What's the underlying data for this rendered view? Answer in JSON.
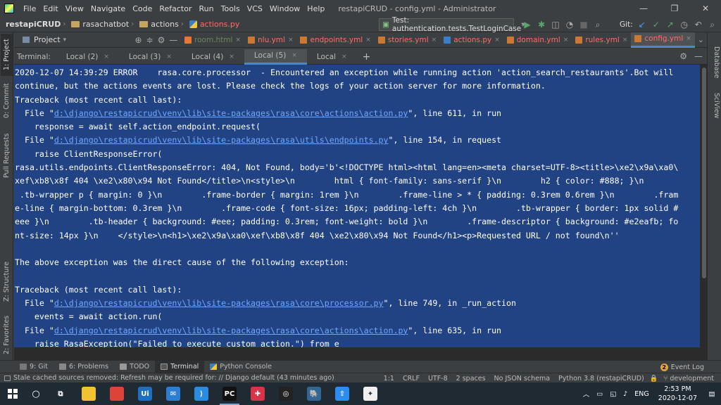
{
  "titlebar": {
    "menu": [
      "File",
      "Edit",
      "View",
      "Navigate",
      "Code",
      "Refactor",
      "Run",
      "Tools",
      "VCS",
      "Window",
      "Help"
    ],
    "title": "restapiCRUD - config.yml - Administrator",
    "minimize": "—",
    "restore": "❐",
    "close": "✕"
  },
  "navbar": {
    "crumbs": [
      "restapiCRUD",
      "rasachatbot",
      "actions",
      "actions.py"
    ],
    "run_config": "Test: authentication.tests.TestLoginCase",
    "git_label": "Git:"
  },
  "project_panel": {
    "label": "Project"
  },
  "editor_tabs": [
    {
      "label": "room.html",
      "color": "#6a8759",
      "icon_color": "#e37933"
    },
    {
      "label": "nlu.yml",
      "color": "#ff6b68",
      "icon_color": "#cc7832"
    },
    {
      "label": "endpoints.yml",
      "color": "#ff6b68",
      "icon_color": "#cc7832"
    },
    {
      "label": "stories.yml",
      "color": "#ff6b68",
      "icon_color": "#cc7832"
    },
    {
      "label": "actions.py",
      "color": "#ff6b68",
      "icon_color": "#3d7cc7"
    },
    {
      "label": "domain.yml",
      "color": "#ff6b68",
      "icon_color": "#cc7832"
    },
    {
      "label": "rules.yml",
      "color": "#ff6b68",
      "icon_color": "#cc7832"
    },
    {
      "label": "config.yml",
      "color": "#ff6b68",
      "icon_color": "#cc7832"
    }
  ],
  "terminal": {
    "label": "Terminal:",
    "tabs": [
      "Local (2)",
      "Local (3)",
      "Local (4)",
      "Local (5)",
      "Local"
    ],
    "active_tab": 3,
    "lines": [
      [
        {
          "t": "2020-12-07 14:39:29 ERROR    rasa.core.processor  - Encountered an exception while running action 'action_search_restaurants'.Bot will"
        }
      ],
      [
        {
          "t": "continue, but the actions events are lost. Please check the logs of your action server for more information."
        }
      ],
      [
        {
          "t": "Traceback (most recent call last):"
        }
      ],
      [
        {
          "t": "  File \""
        },
        {
          "t": "d:\\django\\restapicrud\\venv\\lib\\site-packages\\rasa\\core\\actions\\action.py",
          "link": true
        },
        {
          "t": "\", line 611, in run"
        }
      ],
      [
        {
          "t": "    response = await self.action_endpoint.request("
        }
      ],
      [
        {
          "t": "  File \""
        },
        {
          "t": "d:\\django\\restapicrud\\venv\\lib\\site-packages\\rasa\\utils\\endpoints.py",
          "link": true
        },
        {
          "t": "\", line 154, in request"
        }
      ],
      [
        {
          "t": "    raise ClientResponseError("
        }
      ],
      [
        {
          "t": "rasa.utils.endpoints.ClientResponseError: 404, Not Found, body='b'<!DOCTYPE html><html lang=en><meta charset=UTF-8><title>\\xe2\\x9a\\xa0\\"
        }
      ],
      [
        {
          "t": "xef\\xb8\\x8f 404 \\xe2\\x80\\x94 Not Found</title>\\n<style>\\n        html { font-family: sans-serif }\\n        h2 { color: #888; }\\n"
        }
      ],
      [
        {
          "t": " .tb-wrapper p { margin: 0 }\\n        .frame-border { margin: 1rem }\\n        .frame-line > * { padding: 0.3rem 0.6rem }\\n        .fram"
        }
      ],
      [
        {
          "t": "e-line { margin-bottom: 0.3rem }\\n        .frame-code { font-size: 16px; padding-left: 4ch }\\n        .tb-wrapper { border: 1px solid #"
        }
      ],
      [
        {
          "t": "eee }\\n        .tb-header { background: #eee; padding: 0.3rem; font-weight: bold }\\n        .frame-descriptor { background: #e2eafb; fo"
        }
      ],
      [
        {
          "t": "nt-size: 14px }\\n    </style>\\n<h1>\\xe2\\x9a\\xa0\\xef\\xb8\\x8f 404 \\xe2\\x80\\x94 Not Found</h1><p>Requested URL / not found\\n''"
        }
      ],
      [
        {
          "t": ""
        }
      ],
      [
        {
          "t": "The above exception was the direct cause of the following exception:"
        }
      ],
      [
        {
          "t": ""
        }
      ],
      [
        {
          "t": "Traceback (most recent call last):"
        }
      ],
      [
        {
          "t": "  File \""
        },
        {
          "t": "d:\\django\\restapicrud\\venv\\lib\\site-packages\\rasa\\core\\processor.py",
          "link": true
        },
        {
          "t": "\", line 749, in _run_action"
        }
      ],
      [
        {
          "t": "    events = await action.run("
        }
      ],
      [
        {
          "t": "  File \""
        },
        {
          "t": "d:\\django\\restapicrud\\venv\\lib\\site-packages\\rasa\\core\\actions\\action.py",
          "link": true
        },
        {
          "t": "\", line 635, in run"
        }
      ],
      [
        {
          "t": "    raise RasaException(\"Failed to execute custom action.\") from e"
        }
      ]
    ]
  },
  "left_stripe": [
    "1: Project",
    "0: Commit",
    "Pull Requests",
    "Z: Structure",
    "2: Favorites"
  ],
  "right_stripe": [
    "Database",
    "SciView"
  ],
  "bottom_tools": [
    "9: Git",
    "6: Problems",
    "TODO",
    "Terminal",
    "Python Console"
  ],
  "event_log": {
    "count": "2",
    "label": "Event Log"
  },
  "statusbar": {
    "message": "Stale cached sources removed: Refresh may be required for: // Django default (43 minutes ago)",
    "items": [
      "1:1",
      "CRLF",
      "UTF-8",
      "2 spaces",
      "No JSON schema",
      "Python 3.8 (restapiCRUD)",
      "development"
    ]
  },
  "taskbar": {
    "apps": [
      {
        "name": "task-view",
        "glyph": "⧉",
        "bg": "transparent"
      },
      {
        "name": "file-explorer",
        "glyph": "",
        "bg": "#f1c232"
      },
      {
        "name": "chrome",
        "glyph": "",
        "bg": "#db4437"
      },
      {
        "name": "uipath",
        "glyph": "Ui",
        "bg": "#1e6fc2"
      },
      {
        "name": "mail",
        "glyph": "✉",
        "bg": "#2d7dd2"
      },
      {
        "name": "vscode",
        "glyph": "⟩",
        "bg": "#2a8be0"
      },
      {
        "name": "pycharm",
        "glyph": "PC",
        "bg": "#111111"
      },
      {
        "name": "app-red",
        "glyph": "✚",
        "bg": "#d9334a"
      },
      {
        "name": "app-circle",
        "glyph": "◎",
        "bg": "#222222"
      },
      {
        "name": "postgres",
        "glyph": "🐘",
        "bg": "#336791"
      },
      {
        "name": "upload",
        "glyph": "⇧",
        "bg": "#2d8cf0"
      },
      {
        "name": "app-git",
        "glyph": "✦",
        "bg": "#f0f0f0"
      }
    ],
    "language": "ENG",
    "time": "2:53 PM",
    "date": "2020-12-07"
  }
}
